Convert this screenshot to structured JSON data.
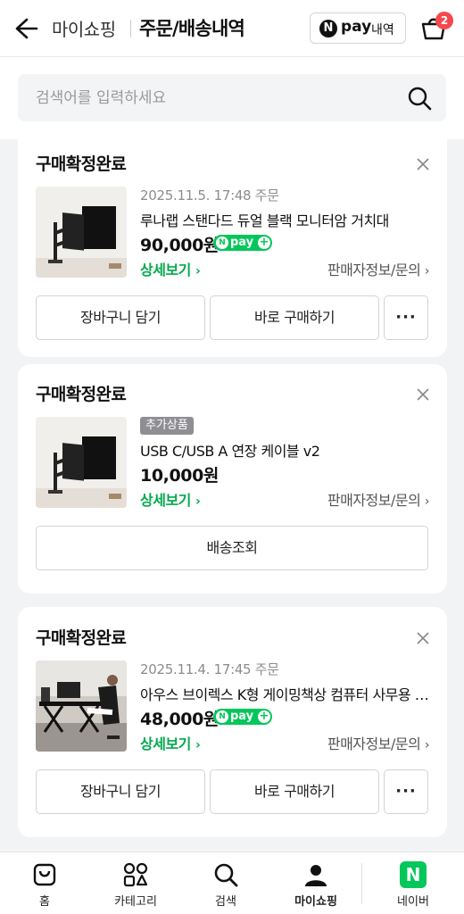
{
  "header": {
    "breadcrumb": "마이쇼핑",
    "title": "주문/배송내역",
    "npay_label_n": "N",
    "npay_label_pay": "pay",
    "npay_label_hist": "내역",
    "cart_count": "2"
  },
  "search": {
    "placeholder": "검색어를 입력하세요"
  },
  "orders": [
    {
      "status": "구매확정완료",
      "date": "2025.11.5. 17:48 주문",
      "name": "루나랩 스탠다드 듀얼 블랙 모니터암 거치대",
      "price": "90,000원",
      "detail": "상세보기",
      "seller": "판매자정보/문의",
      "btn_cart": "장바구니 담기",
      "btn_buy": "바로 구매하기"
    },
    {
      "status": "구매확정완료",
      "tag": "추가상품",
      "name": "USB C/USB A 연장 케이블 v2",
      "price": "10,000원",
      "detail": "상세보기",
      "seller": "판매자정보/문의",
      "btn_track": "배송조회"
    },
    {
      "status": "구매확정완료",
      "date": "2025.11.4. 17:45 주문",
      "name": "아우스 브이렉스 K형 게이밍책상 컴퓨터 사무용 책상",
      "price": "48,000원",
      "detail": "상세보기",
      "seller": "판매자정보/문의",
      "btn_cart": "장바구니 담기",
      "btn_buy": "바로 구매하기"
    }
  ],
  "npayplus": {
    "n": "N",
    "text": "pay",
    "plus": "+"
  },
  "nav": {
    "home": "홈",
    "category": "카테고리",
    "search": "검색",
    "myshop": "마이쇼핑",
    "naver": "네이버",
    "naver_n": "N"
  },
  "colors": {
    "accent_green": "#03c75a",
    "badge_red": "#f4484e"
  }
}
